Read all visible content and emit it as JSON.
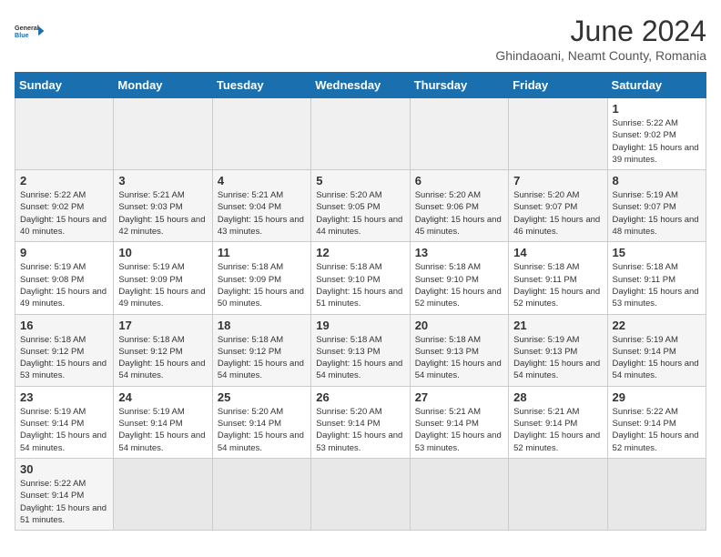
{
  "logo": {
    "text_general": "General",
    "text_blue": "Blue"
  },
  "title": "June 2024",
  "subtitle": "Ghindaoani, Neamt County, Romania",
  "days_of_week": [
    "Sunday",
    "Monday",
    "Tuesday",
    "Wednesday",
    "Thursday",
    "Friday",
    "Saturday"
  ],
  "weeks": [
    [
      {
        "day": "",
        "empty": true
      },
      {
        "day": "",
        "empty": true
      },
      {
        "day": "",
        "empty": true
      },
      {
        "day": "",
        "empty": true
      },
      {
        "day": "",
        "empty": true
      },
      {
        "day": "",
        "empty": true
      },
      {
        "day": "1",
        "sunrise": "5:22 AM",
        "sunset": "9:02 PM",
        "daylight": "15 hours and 39 minutes."
      }
    ],
    [
      {
        "day": "2",
        "sunrise": "5:22 AM",
        "sunset": "9:02 PM",
        "daylight": "15 hours and 40 minutes."
      },
      {
        "day": "3",
        "sunrise": "5:21 AM",
        "sunset": "9:03 PM",
        "daylight": "15 hours and 42 minutes."
      },
      {
        "day": "4",
        "sunrise": "5:21 AM",
        "sunset": "9:04 PM",
        "daylight": "15 hours and 43 minutes."
      },
      {
        "day": "5",
        "sunrise": "5:20 AM",
        "sunset": "9:05 PM",
        "daylight": "15 hours and 44 minutes."
      },
      {
        "day": "6",
        "sunrise": "5:20 AM",
        "sunset": "9:06 PM",
        "daylight": "15 hours and 45 minutes."
      },
      {
        "day": "7",
        "sunrise": "5:20 AM",
        "sunset": "9:07 PM",
        "daylight": "15 hours and 46 minutes."
      },
      {
        "day": "8",
        "sunrise": "5:19 AM",
        "sunset": "9:07 PM",
        "daylight": "15 hours and 48 minutes."
      }
    ],
    [
      {
        "day": "9",
        "sunrise": "5:19 AM",
        "sunset": "9:08 PM",
        "daylight": "15 hours and 49 minutes."
      },
      {
        "day": "10",
        "sunrise": "5:19 AM",
        "sunset": "9:09 PM",
        "daylight": "15 hours and 49 minutes."
      },
      {
        "day": "11",
        "sunrise": "5:18 AM",
        "sunset": "9:09 PM",
        "daylight": "15 hours and 50 minutes."
      },
      {
        "day": "12",
        "sunrise": "5:18 AM",
        "sunset": "9:10 PM",
        "daylight": "15 hours and 51 minutes."
      },
      {
        "day": "13",
        "sunrise": "5:18 AM",
        "sunset": "9:10 PM",
        "daylight": "15 hours and 52 minutes."
      },
      {
        "day": "14",
        "sunrise": "5:18 AM",
        "sunset": "9:11 PM",
        "daylight": "15 hours and 52 minutes."
      },
      {
        "day": "15",
        "sunrise": "5:18 AM",
        "sunset": "9:11 PM",
        "daylight": "15 hours and 53 minutes."
      }
    ],
    [
      {
        "day": "16",
        "sunrise": "5:18 AM",
        "sunset": "9:12 PM",
        "daylight": "15 hours and 53 minutes."
      },
      {
        "day": "17",
        "sunrise": "5:18 AM",
        "sunset": "9:12 PM",
        "daylight": "15 hours and 54 minutes."
      },
      {
        "day": "18",
        "sunrise": "5:18 AM",
        "sunset": "9:12 PM",
        "daylight": "15 hours and 54 minutes."
      },
      {
        "day": "19",
        "sunrise": "5:18 AM",
        "sunset": "9:13 PM",
        "daylight": "15 hours and 54 minutes."
      },
      {
        "day": "20",
        "sunrise": "5:18 AM",
        "sunset": "9:13 PM",
        "daylight": "15 hours and 54 minutes."
      },
      {
        "day": "21",
        "sunrise": "5:19 AM",
        "sunset": "9:13 PM",
        "daylight": "15 hours and 54 minutes."
      },
      {
        "day": "22",
        "sunrise": "5:19 AM",
        "sunset": "9:14 PM",
        "daylight": "15 hours and 54 minutes."
      }
    ],
    [
      {
        "day": "23",
        "sunrise": "5:19 AM",
        "sunset": "9:14 PM",
        "daylight": "15 hours and 54 minutes."
      },
      {
        "day": "24",
        "sunrise": "5:19 AM",
        "sunset": "9:14 PM",
        "daylight": "15 hours and 54 minutes."
      },
      {
        "day": "25",
        "sunrise": "5:20 AM",
        "sunset": "9:14 PM",
        "daylight": "15 hours and 54 minutes."
      },
      {
        "day": "26",
        "sunrise": "5:20 AM",
        "sunset": "9:14 PM",
        "daylight": "15 hours and 53 minutes."
      },
      {
        "day": "27",
        "sunrise": "5:21 AM",
        "sunset": "9:14 PM",
        "daylight": "15 hours and 53 minutes."
      },
      {
        "day": "28",
        "sunrise": "5:21 AM",
        "sunset": "9:14 PM",
        "daylight": "15 hours and 52 minutes."
      },
      {
        "day": "29",
        "sunrise": "5:22 AM",
        "sunset": "9:14 PM",
        "daylight": "15 hours and 52 minutes."
      }
    ],
    [
      {
        "day": "30",
        "sunrise": "5:22 AM",
        "sunset": "9:14 PM",
        "daylight": "15 hours and 51 minutes."
      },
      {
        "day": "",
        "empty": true
      },
      {
        "day": "",
        "empty": true
      },
      {
        "day": "",
        "empty": true
      },
      {
        "day": "",
        "empty": true
      },
      {
        "day": "",
        "empty": true
      },
      {
        "day": "",
        "empty": true
      }
    ]
  ]
}
